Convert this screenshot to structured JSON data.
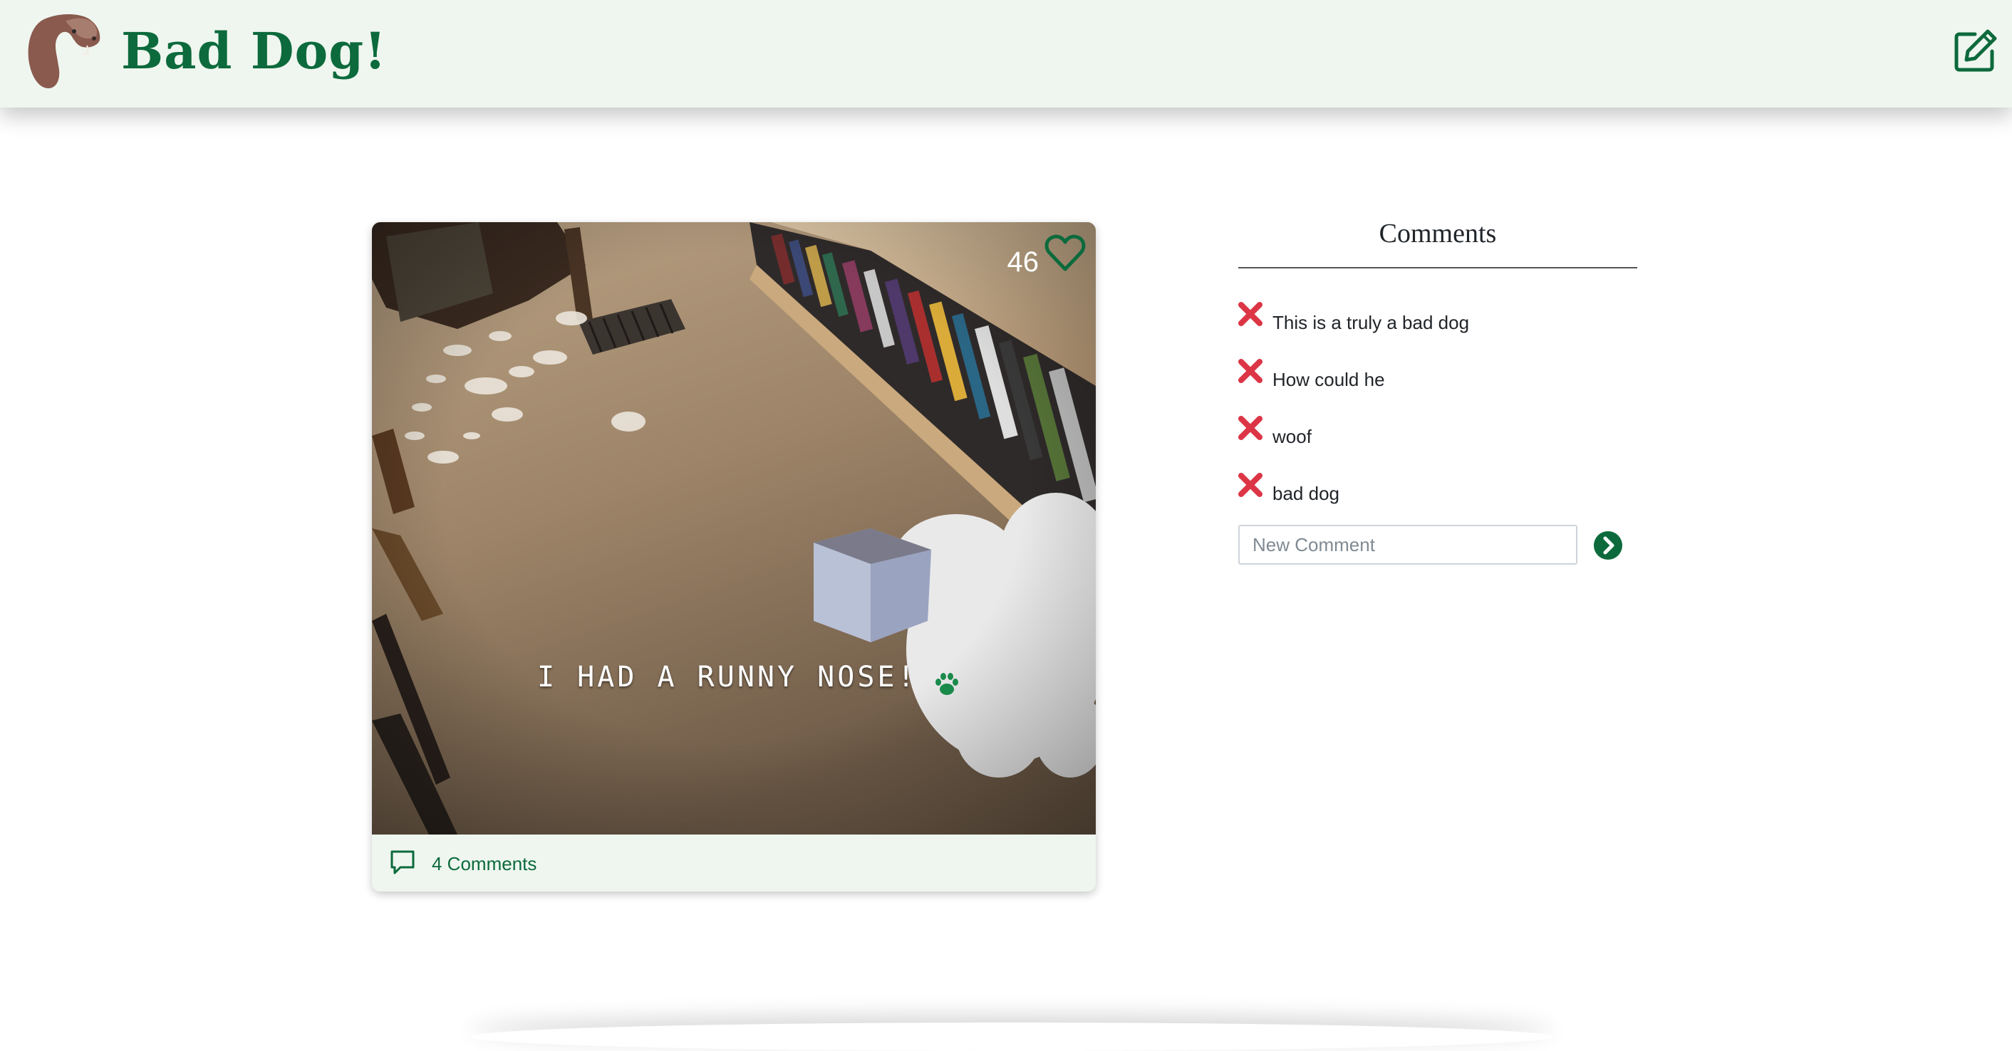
{
  "header": {
    "brand_title": "Bad Dog!",
    "logo_icon": "dog-head-logo",
    "edit_icon": "edit-icon"
  },
  "post": {
    "likes": "46",
    "caption": "I HAD A RUNNY NOSE!",
    "caption_icon": "paw-icon",
    "comments_label": "4 Comments"
  },
  "comments_panel": {
    "title": "Comments",
    "items": [
      {
        "text": "This is a truly a bad dog"
      },
      {
        "text": "How could he"
      },
      {
        "text": "woof"
      },
      {
        "text": "bad dog"
      }
    ],
    "new_comment": {
      "placeholder": "New Comment",
      "value": ""
    },
    "submit_icon": "chevron-right-circle-icon"
  },
  "colors": {
    "brand_green": "#0c6a3c",
    "header_bg": "#eff6ef",
    "delete_red": "#dc3545",
    "logo_brown": "#8a5a4e"
  }
}
